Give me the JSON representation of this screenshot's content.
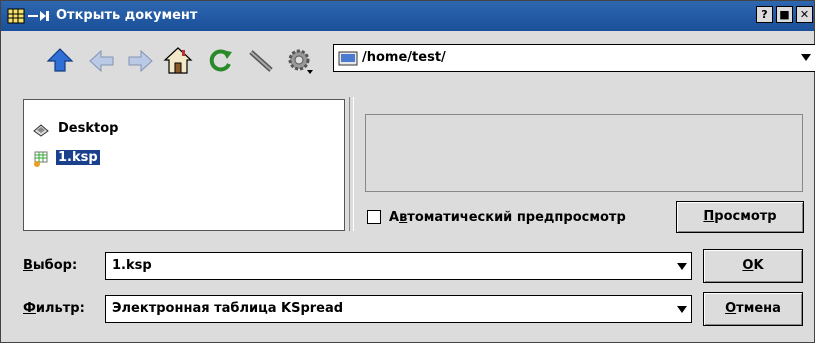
{
  "window": {
    "title": "Открыть документ",
    "controls": {
      "help": "?",
      "maximize": "■",
      "close": "✕"
    }
  },
  "toolbar": {
    "icons": [
      "up-arrow-icon",
      "back-arrow-icon",
      "forward-arrow-icon",
      "home-icon",
      "reload-icon",
      "new-folder-icon",
      "settings-gear-icon"
    ],
    "path": "/home/test/"
  },
  "file_list": {
    "items": [
      {
        "label": "Desktop",
        "icon": "desktop-folder-icon",
        "selected": false
      },
      {
        "label": "1.ksp",
        "icon": "kspread-file-icon",
        "selected": true
      }
    ]
  },
  "preview": {
    "auto_preview_prefix": "А",
    "auto_preview_access": "в",
    "auto_preview_rest": "томатический предпросмотр",
    "auto_preview_checked": false,
    "preview_button_access": "П",
    "preview_button_rest": "росмотр"
  },
  "selection": {
    "label_access": "В",
    "label_rest": "ыбор:",
    "value": "1.ksp"
  },
  "filter": {
    "label_access": "Ф",
    "label_rest": "ильтр:",
    "value": "Электронная таблица KSpread"
  },
  "buttons": {
    "ok_access": "O",
    "ok_rest": "K",
    "cancel_access": "О",
    "cancel_rest": "тмена"
  }
}
